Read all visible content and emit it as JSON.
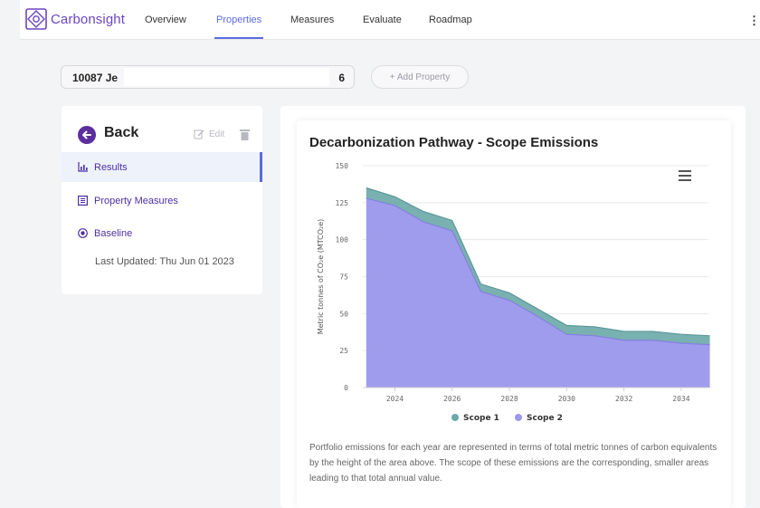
{
  "app": {
    "name": "Carbonsight"
  },
  "nav": {
    "items": [
      {
        "label": "Overview"
      },
      {
        "label": "Properties"
      },
      {
        "label": "Measures"
      },
      {
        "label": "Evaluate"
      },
      {
        "label": "Roadmap"
      }
    ],
    "active": "Properties",
    "more_glyph": "⋮"
  },
  "property": {
    "address_start": "10087 Je",
    "address_end": "6",
    "add_button": "+ Add Property"
  },
  "sidebar": {
    "back_label": "Back",
    "edit_label": "Edit",
    "items": [
      {
        "label": "Results",
        "icon": "bar-chart-icon"
      },
      {
        "label": "Property Measures",
        "icon": "list-icon"
      },
      {
        "label": "Baseline",
        "icon": "target-icon"
      }
    ],
    "last_updated": "Last Updated: Thu Jun 01 2023"
  },
  "colors": {
    "accent": "#5b6be0",
    "brand": "#6b46c1",
    "scope1": "#6aa9a8",
    "scope2": "#9b97ec"
  },
  "chart": {
    "caption": "Portfolio emissions for each year are represented in terms of total metric tonnes of carbon equivalents by the height of the area above. The scope of these emissions are the corresponding, smaller areas leading to that total annual value."
  },
  "chart_data": {
    "type": "area",
    "title": "Decarbonization Pathway - Scope Emissions",
    "ylabel": "Metric tonnes of CO₂e (MTCO₂e)",
    "xlabel": "",
    "stacked": true,
    "x": [
      2023,
      2024,
      2025,
      2026,
      2027,
      2028,
      2029,
      2030,
      2031,
      2032,
      2033,
      2034,
      2035
    ],
    "xticks": [
      2024,
      2026,
      2028,
      2030,
      2032,
      2034
    ],
    "yticks": [
      0,
      25,
      50,
      75,
      100,
      125,
      150
    ],
    "ylim": [
      0,
      150
    ],
    "legend": "bottom",
    "series": [
      {
        "name": "Scope 1",
        "color": "#6aa9a8",
        "values": [
          7,
          6,
          7,
          7,
          5,
          5,
          5,
          6,
          6,
          6,
          6,
          6,
          6
        ]
      },
      {
        "name": "Scope 2",
        "color": "#9b97ec",
        "values": [
          128,
          123,
          112,
          106,
          65,
          59,
          48,
          36,
          35,
          32,
          32,
          30,
          29
        ]
      }
    ]
  }
}
